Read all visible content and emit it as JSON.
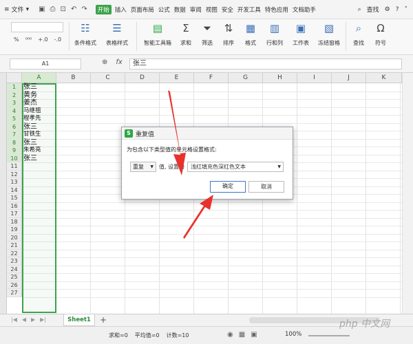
{
  "menubar": {
    "file_label": "文件",
    "tabs": [
      "开始",
      "插入",
      "页面布局",
      "公式",
      "数据",
      "审阅",
      "视图",
      "安全",
      "开发工具",
      "特色应用",
      "文档助手"
    ],
    "active_tab": "开始",
    "search_label": "查找",
    "accent_color": "#3aa34a"
  },
  "ribbon": {
    "buttons": [
      {
        "icon": "conditional-format-icon",
        "label": "条件格式"
      },
      {
        "icon": "table-style-icon",
        "label": "表格样式"
      },
      {
        "icon": "smart-toolbox-icon",
        "label": "智能工具箱"
      },
      {
        "icon": "sum-icon",
        "label": "求和"
      },
      {
        "icon": "filter-icon",
        "label": "筛选"
      },
      {
        "icon": "sort-icon",
        "label": "排序"
      },
      {
        "icon": "format-icon",
        "label": "格式"
      },
      {
        "icon": "rows-cols-icon",
        "label": "行和列"
      },
      {
        "icon": "worksheet-icon",
        "label": "工作表"
      },
      {
        "icon": "freeze-pane-icon",
        "label": "冻结窗格"
      },
      {
        "icon": "find-icon",
        "label": "查找"
      },
      {
        "icon": "symbol-icon",
        "label": "符号"
      }
    ]
  },
  "formula": {
    "cell_ref": "A1",
    "fx": "fx",
    "value": "张三"
  },
  "grid": {
    "columns": [
      "A",
      "B",
      "C",
      "D",
      "E",
      "F",
      "G",
      "H",
      "I",
      "J",
      "K"
    ],
    "selected_column": "A",
    "rows": [
      "1",
      "2",
      "3",
      "4",
      "5",
      "6",
      "7",
      "8",
      "9",
      "10",
      "11",
      "12",
      "13",
      "14",
      "15",
      "16",
      "17",
      "18",
      "19",
      "20",
      "21",
      "22",
      "23",
      "24",
      "25",
      "26",
      "27"
    ],
    "col_a_values": [
      "张三",
      "黄务",
      "姜杰",
      "马继祖",
      "程孝先",
      "张三",
      "甘铁生",
      "张三",
      "朱希亮",
      "张三"
    ]
  },
  "sheet_tab": "Sheet1",
  "status": {
    "sum": "求和=0",
    "avg": "平均值=0",
    "count": "计数=10",
    "zoom": "100%"
  },
  "dialog": {
    "title": "重复值",
    "prompt": "为包含以下类型值的单元格设置格式:",
    "type_value": "重复",
    "middle_text": "值, 设置为",
    "format_value": "浅红填充色深红色文本",
    "ok_label": "确定",
    "cancel_label": "取消"
  },
  "watermark": "php 中文网"
}
